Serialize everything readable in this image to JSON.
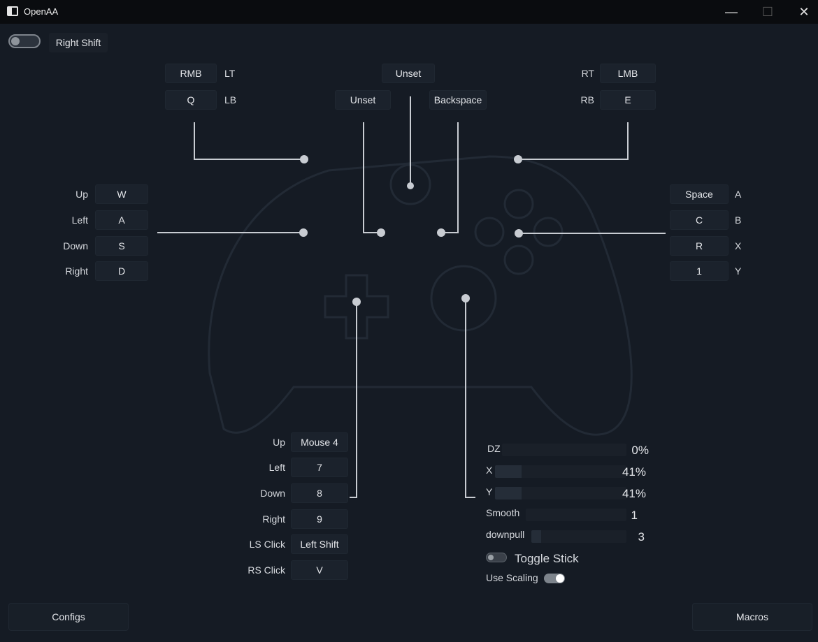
{
  "window": {
    "title": "OpenAA",
    "minimize": "—",
    "maximize": "☐",
    "close": "✕"
  },
  "header": {
    "toggle_state": "off",
    "toggle_label": "Right Shift"
  },
  "triggers": {
    "lt_key": "RMB",
    "lt_label": "LT",
    "lb_key": "Q",
    "lb_label": "LB",
    "rt_key": "LMB",
    "rt_label": "RT",
    "rb_key": "E",
    "rb_label": "RB"
  },
  "center": {
    "guide_key": "Unset",
    "view_key": "Unset",
    "menu_key": "Backspace"
  },
  "left_stick": {
    "rows": [
      {
        "label": "Up",
        "key": "W"
      },
      {
        "label": "Left",
        "key": "A"
      },
      {
        "label": "Down",
        "key": "S"
      },
      {
        "label": "Right",
        "key": "D"
      }
    ]
  },
  "face_buttons": {
    "rows": [
      {
        "key": "Space",
        "label": "A"
      },
      {
        "key": "C",
        "label": "B"
      },
      {
        "key": "R",
        "label": "X"
      },
      {
        "key": "1",
        "label": "Y"
      }
    ]
  },
  "dpad": {
    "rows": [
      {
        "label": "Up",
        "key": "Mouse 4"
      },
      {
        "label": "Left",
        "key": "7"
      },
      {
        "label": "Down",
        "key": "8"
      },
      {
        "label": "Right",
        "key": "9"
      },
      {
        "label": "LS Click",
        "key": "Left Shift"
      },
      {
        "label": "RS Click",
        "key": "V"
      }
    ]
  },
  "stick_settings": {
    "dz": {
      "label": "DZ",
      "value": "0%",
      "fraction": 0.0
    },
    "x": {
      "label": "X",
      "value": "41%",
      "fraction": 0.2
    },
    "y": {
      "label": "Y",
      "value": "41%",
      "fraction": 0.2
    },
    "smooth": {
      "label": "Smooth",
      "value": "1",
      "fraction": 0.0
    },
    "downpull": {
      "label": "downpull",
      "value": "3",
      "fraction": 0.1
    },
    "toggle_stick": {
      "label": "Toggle Stick",
      "state": "off"
    },
    "use_scaling": {
      "label": "Use Scaling",
      "state": "on"
    }
  },
  "footer": {
    "configs_label": "Configs",
    "macros_label": "Macros"
  },
  "colors": {
    "background": "#151b24",
    "titlebar": "#0a0c0f",
    "key_box": "#1b222c",
    "connector": "#c8ccd2"
  }
}
